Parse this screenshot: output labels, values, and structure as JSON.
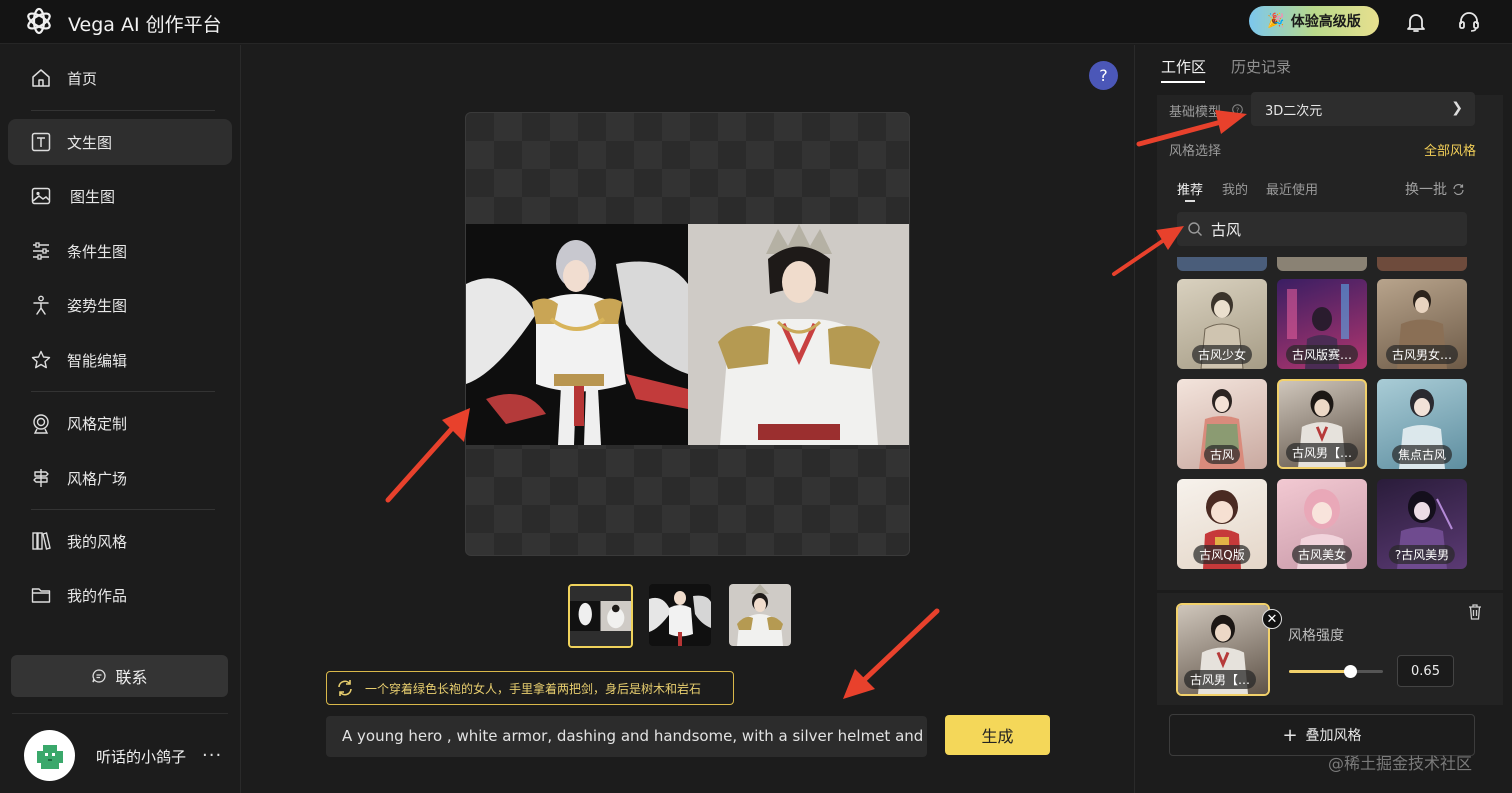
{
  "header": {
    "app_title": "Vega AI 创作平台",
    "upgrade_label": "体验高级版",
    "icons": [
      "logo-icon",
      "bell-icon",
      "headset-icon"
    ]
  },
  "sidebar": {
    "items": [
      {
        "label": "首页",
        "icon": "home-icon",
        "active": false
      },
      {
        "label": "文生图",
        "icon": "text-to-image-icon",
        "active": true
      },
      {
        "label": "图生图",
        "icon": "image-icon",
        "active": false
      },
      {
        "label": "条件生图",
        "icon": "sliders-icon",
        "active": false
      },
      {
        "label": "姿势生图",
        "icon": "pose-icon",
        "active": false
      },
      {
        "label": "智能编辑",
        "icon": "star-edit-icon",
        "active": false
      },
      {
        "label": "风格定制",
        "icon": "target-icon",
        "active": false
      },
      {
        "label": "风格广场",
        "icon": "signpost-icon",
        "active": false
      },
      {
        "label": "我的风格",
        "icon": "books-icon",
        "active": false
      },
      {
        "label": "我的作品",
        "icon": "folder-icon",
        "active": false
      }
    ],
    "contact_label": "联系",
    "user_name": "听话的小鸽子",
    "more_label": "···"
  },
  "main": {
    "help_label": "?",
    "translation": "一个穿着绿色长袍的女人，手里拿着两把剑，身后是树木和岩石",
    "prompt_value": "A young hero , white armor, dashing and handsome, with a silver helmet and a red",
    "generate_label": "生成",
    "thumbnail_count": 3
  },
  "right_panel": {
    "tabs": [
      {
        "label": "工作区",
        "active": true
      },
      {
        "label": "历史记录",
        "active": false
      }
    ],
    "model_label": "基础模型",
    "model_value": "3D二次元",
    "style_select_label": "风格选择",
    "all_styles_label": "全部风格",
    "style_tabs": [
      {
        "label": "推荐",
        "active": true
      },
      {
        "label": "我的",
        "active": false
      },
      {
        "label": "最近使用",
        "active": false
      }
    ],
    "refresh_label": "换一批",
    "search_value": "古风",
    "style_tiles": [
      {
        "label": "古风少女",
        "selected": false
      },
      {
        "label": "古风版赛…",
        "selected": false
      },
      {
        "label": "古风男女…",
        "selected": false
      },
      {
        "label": "古风",
        "selected": false
      },
      {
        "label": "古风男【…",
        "selected": true
      },
      {
        "label": "焦点古风",
        "selected": false
      },
      {
        "label": "古风Q版",
        "selected": false
      },
      {
        "label": "古风美女",
        "selected": false
      },
      {
        "label": "?古风美男",
        "selected": false
      }
    ],
    "chosen_style_label": "古风男【…",
    "strength_label": "风格强度",
    "strength_value": "0.65",
    "strength_fraction": 0.65,
    "add_style_label": "叠加风格"
  },
  "watermark": "@稀土掘金技术社区",
  "colors": {
    "accent_yellow": "#f4d759",
    "background": "#1c1c1c",
    "annotation_arrow": "#e8412c"
  }
}
